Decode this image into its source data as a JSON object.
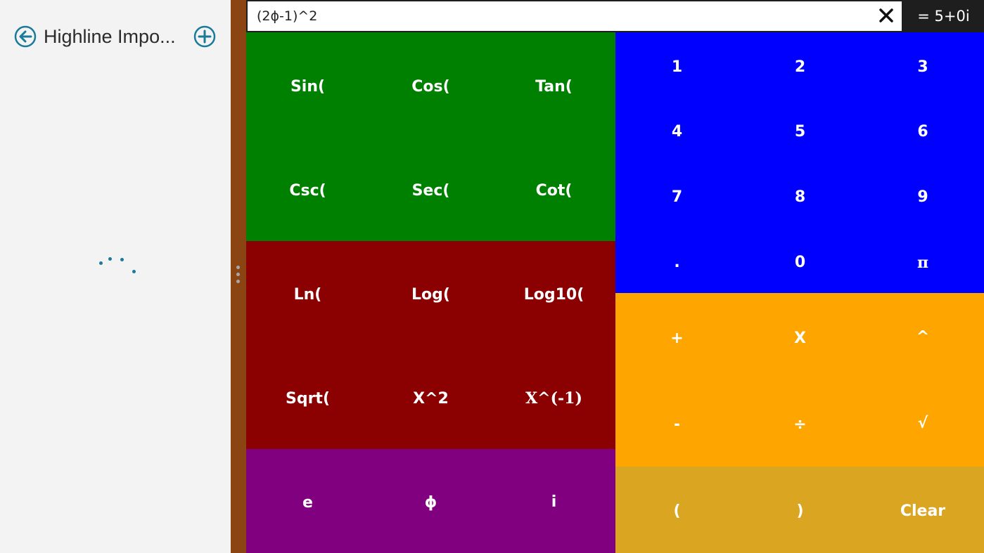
{
  "colors": {
    "trig_bg": "#008000",
    "log_bg": "#8b0000",
    "const_bg": "#800080",
    "digits_bg": "#0000ff",
    "ops_bg": "#ffa500",
    "bottom_bg": "#daa520",
    "splitter": "#8b4513",
    "accent": "#1a7a9a"
  },
  "sidebar": {
    "title": "Highline Impo...",
    "back_icon": "back-arrow-circle-icon",
    "add_icon": "add-circle-icon",
    "loading_icon": "progress-dots-icon"
  },
  "expression": {
    "value": "(2ϕ-1)^2",
    "clear_icon": "close-x-icon",
    "result": "= 5+0i"
  },
  "trig": {
    "sin": "Sin(",
    "cos": "Cos(",
    "tan": "Tan(",
    "csc": "Csc(",
    "sec": "Sec(",
    "cot": "Cot("
  },
  "logs": {
    "ln": "Ln(",
    "log": "Log(",
    "log10": "Log10(",
    "sqrt": "Sqrt(",
    "square": "X^2",
    "inverse": "X^(-1)"
  },
  "constants": {
    "e": "e",
    "phi": "ϕ",
    "i": "i"
  },
  "digits": {
    "d1": "1",
    "d2": "2",
    "d3": "3",
    "d4": "4",
    "d5": "5",
    "d6": "6",
    "d7": "7",
    "d8": "8",
    "d9": "9",
    "dot": ".",
    "d0": "0",
    "pi": "π"
  },
  "operators": {
    "plus": "+",
    "times": "X",
    "power": "^",
    "minus": "-",
    "divide": "÷",
    "root": "√"
  },
  "bottom": {
    "open_paren": "(",
    "close_paren": ")",
    "clear": "Clear"
  }
}
